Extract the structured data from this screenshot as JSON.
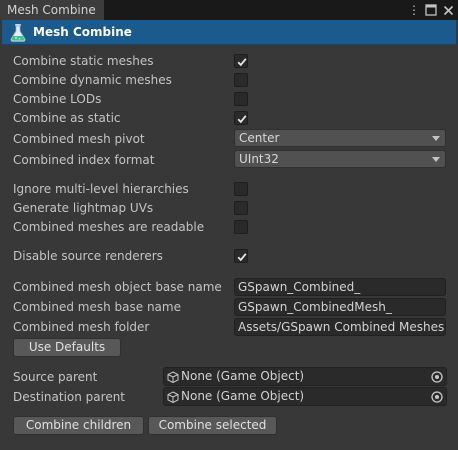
{
  "window": {
    "tab_title": "Mesh Combine",
    "menu_icon": "kebab-menu-icon",
    "maximize_icon": "maximize-icon",
    "close_icon": "close-icon"
  },
  "header": {
    "title": "Mesh Combine",
    "icon": "flask-icon",
    "color": "#1a5a8c"
  },
  "options": {
    "combine_static": {
      "label": "Combine static meshes",
      "checked": true
    },
    "combine_dynamic": {
      "label": "Combine dynamic meshes",
      "checked": false
    },
    "combine_lods": {
      "label": "Combine LODs",
      "checked": false
    },
    "combine_as_static": {
      "label": "Combine as static",
      "checked": true
    },
    "pivot": {
      "label": "Combined mesh pivot",
      "value": "Center"
    },
    "index_format": {
      "label": "Combined index format",
      "value": "UInt32"
    },
    "ignore_hierarchies": {
      "label": "Ignore multi-level hierarchies",
      "checked": false
    },
    "lightmap_uvs": {
      "label": "Generate lightmap UVs",
      "checked": false
    },
    "readable": {
      "label": "Combined meshes are readable",
      "checked": false
    },
    "disable_renderers": {
      "label": "Disable source renderers",
      "checked": true
    },
    "object_base_name": {
      "label": "Combined mesh object base name",
      "value": "GSpawn_Combined_"
    },
    "mesh_base_name": {
      "label": "Combined mesh base name",
      "value": "GSpawn_CombinedMesh_"
    },
    "mesh_folder": {
      "label": "Combined mesh folder",
      "value": "Assets/GSpawn Combined Meshes"
    }
  },
  "buttons": {
    "use_defaults": "Use Defaults",
    "combine_children": "Combine children",
    "combine_selected": "Combine selected"
  },
  "parents": {
    "source": {
      "label": "Source parent",
      "value": "None (Game Object)"
    },
    "destination": {
      "label": "Destination parent",
      "value": "None (Game Object)"
    }
  }
}
